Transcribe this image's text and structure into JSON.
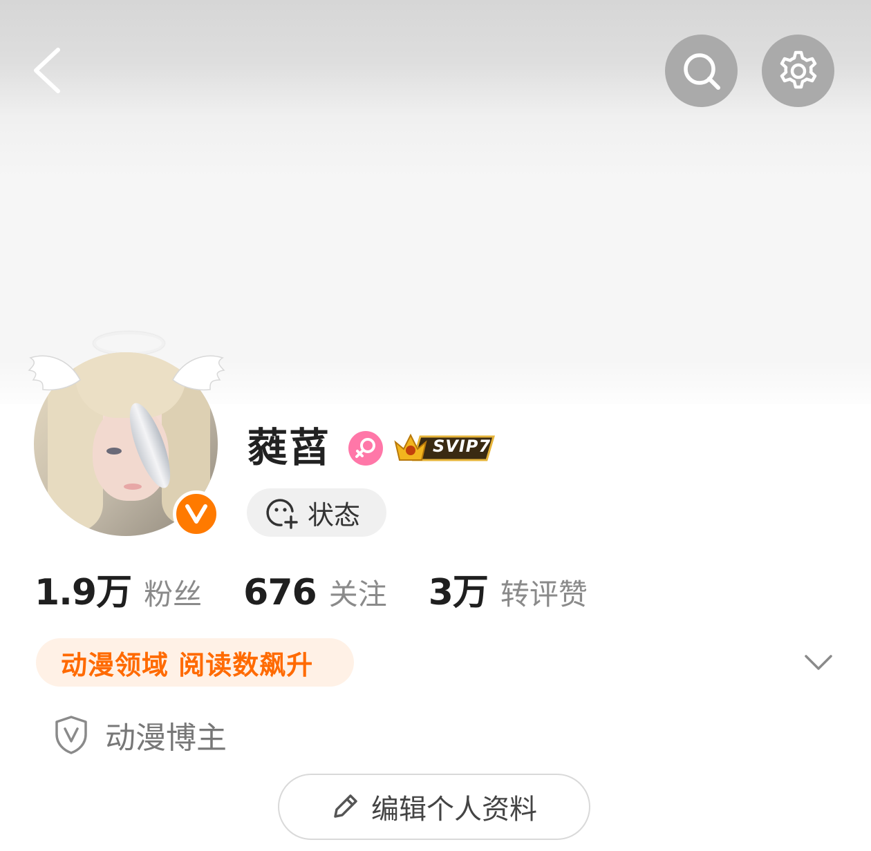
{
  "header": {
    "back_icon": "chevron-left-icon",
    "search_icon": "search-icon",
    "settings_icon": "gear-icon"
  },
  "profile": {
    "username": "蕤蓞",
    "gender_icon": "female-icon",
    "svip_badge": "SVIP7",
    "verified_icon": "v-verified-icon",
    "status_button_label": "状态"
  },
  "stats": [
    {
      "value": "1.9万",
      "label": "粉丝"
    },
    {
      "value": "676",
      "label": "关注"
    },
    {
      "value": "3万",
      "label": "转评赞"
    }
  ],
  "tag": {
    "text": "动漫领域 阅读数飙升",
    "expand_icon": "chevron-down-icon"
  },
  "role": {
    "icon": "shield-v-icon",
    "text": "动漫博主"
  },
  "edit_button": {
    "icon": "pencil-icon",
    "label": "编辑个人资料"
  },
  "colors": {
    "accent": "#ff6a00",
    "tag_bg": "#fff1e6",
    "gender_pink": "#ff77a8",
    "verified_orange": "#ff7a00"
  }
}
